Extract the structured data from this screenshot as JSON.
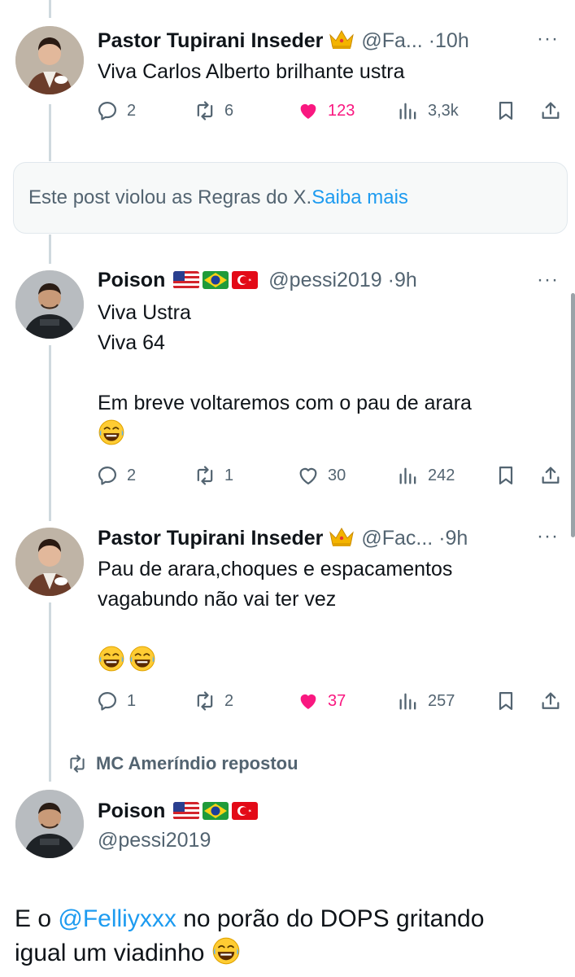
{
  "tweets": [
    {
      "name": "Pastor Tupirani Inseder",
      "handle": "@Fa...",
      "time": "10h",
      "text": [
        "Viva Carlos Alberto brilhante ustra"
      ],
      "replies": "2",
      "reposts": "6",
      "likes": "123",
      "views": "3,3k",
      "liked": true
    },
    {
      "name": "Poison",
      "handle": "@pessi2019",
      "time": "9h",
      "text": [
        "Viva Ustra",
        "Viva 64",
        "Em breve voltaremos com o pau de arara"
      ],
      "replies": "2",
      "reposts": "1",
      "likes": "30",
      "views": "242",
      "liked": false
    },
    {
      "name": "Pastor Tupirani Inseder",
      "handle": "@Fac...",
      "time": "9h",
      "text": [
        "Pau de arara,choques e espacamentos",
        "vagabundo não vai ter vez"
      ],
      "replies": "1",
      "reposts": "2",
      "likes": "37",
      "views": "257",
      "liked": true
    }
  ],
  "notice": {
    "text": "Este post violou as Regras do X.",
    "link": "Saiba mais"
  },
  "repost_banner": "MC Ameríndio repostou",
  "main_post": {
    "name": "Poison",
    "handle": "@pessi2019",
    "text_prefix": "E o ",
    "mention": "@Felliyxxx",
    "text_suffix": " no porão do DOPS gritando",
    "text_line2": "igual um viadinho"
  },
  "separator": "·",
  "more": "···",
  "colors": {
    "accent": "#1d9bf0",
    "like": "#f91880",
    "muted": "#536471",
    "text": "#0f1419"
  },
  "icons": [
    "reply-icon",
    "repost-icon",
    "like-icon",
    "views-icon",
    "bookmark-icon",
    "share-icon",
    "crown-icon",
    "flag-usa-icon",
    "flag-brazil-icon",
    "flag-turkey-icon",
    "laughing-emoji-icon"
  ]
}
